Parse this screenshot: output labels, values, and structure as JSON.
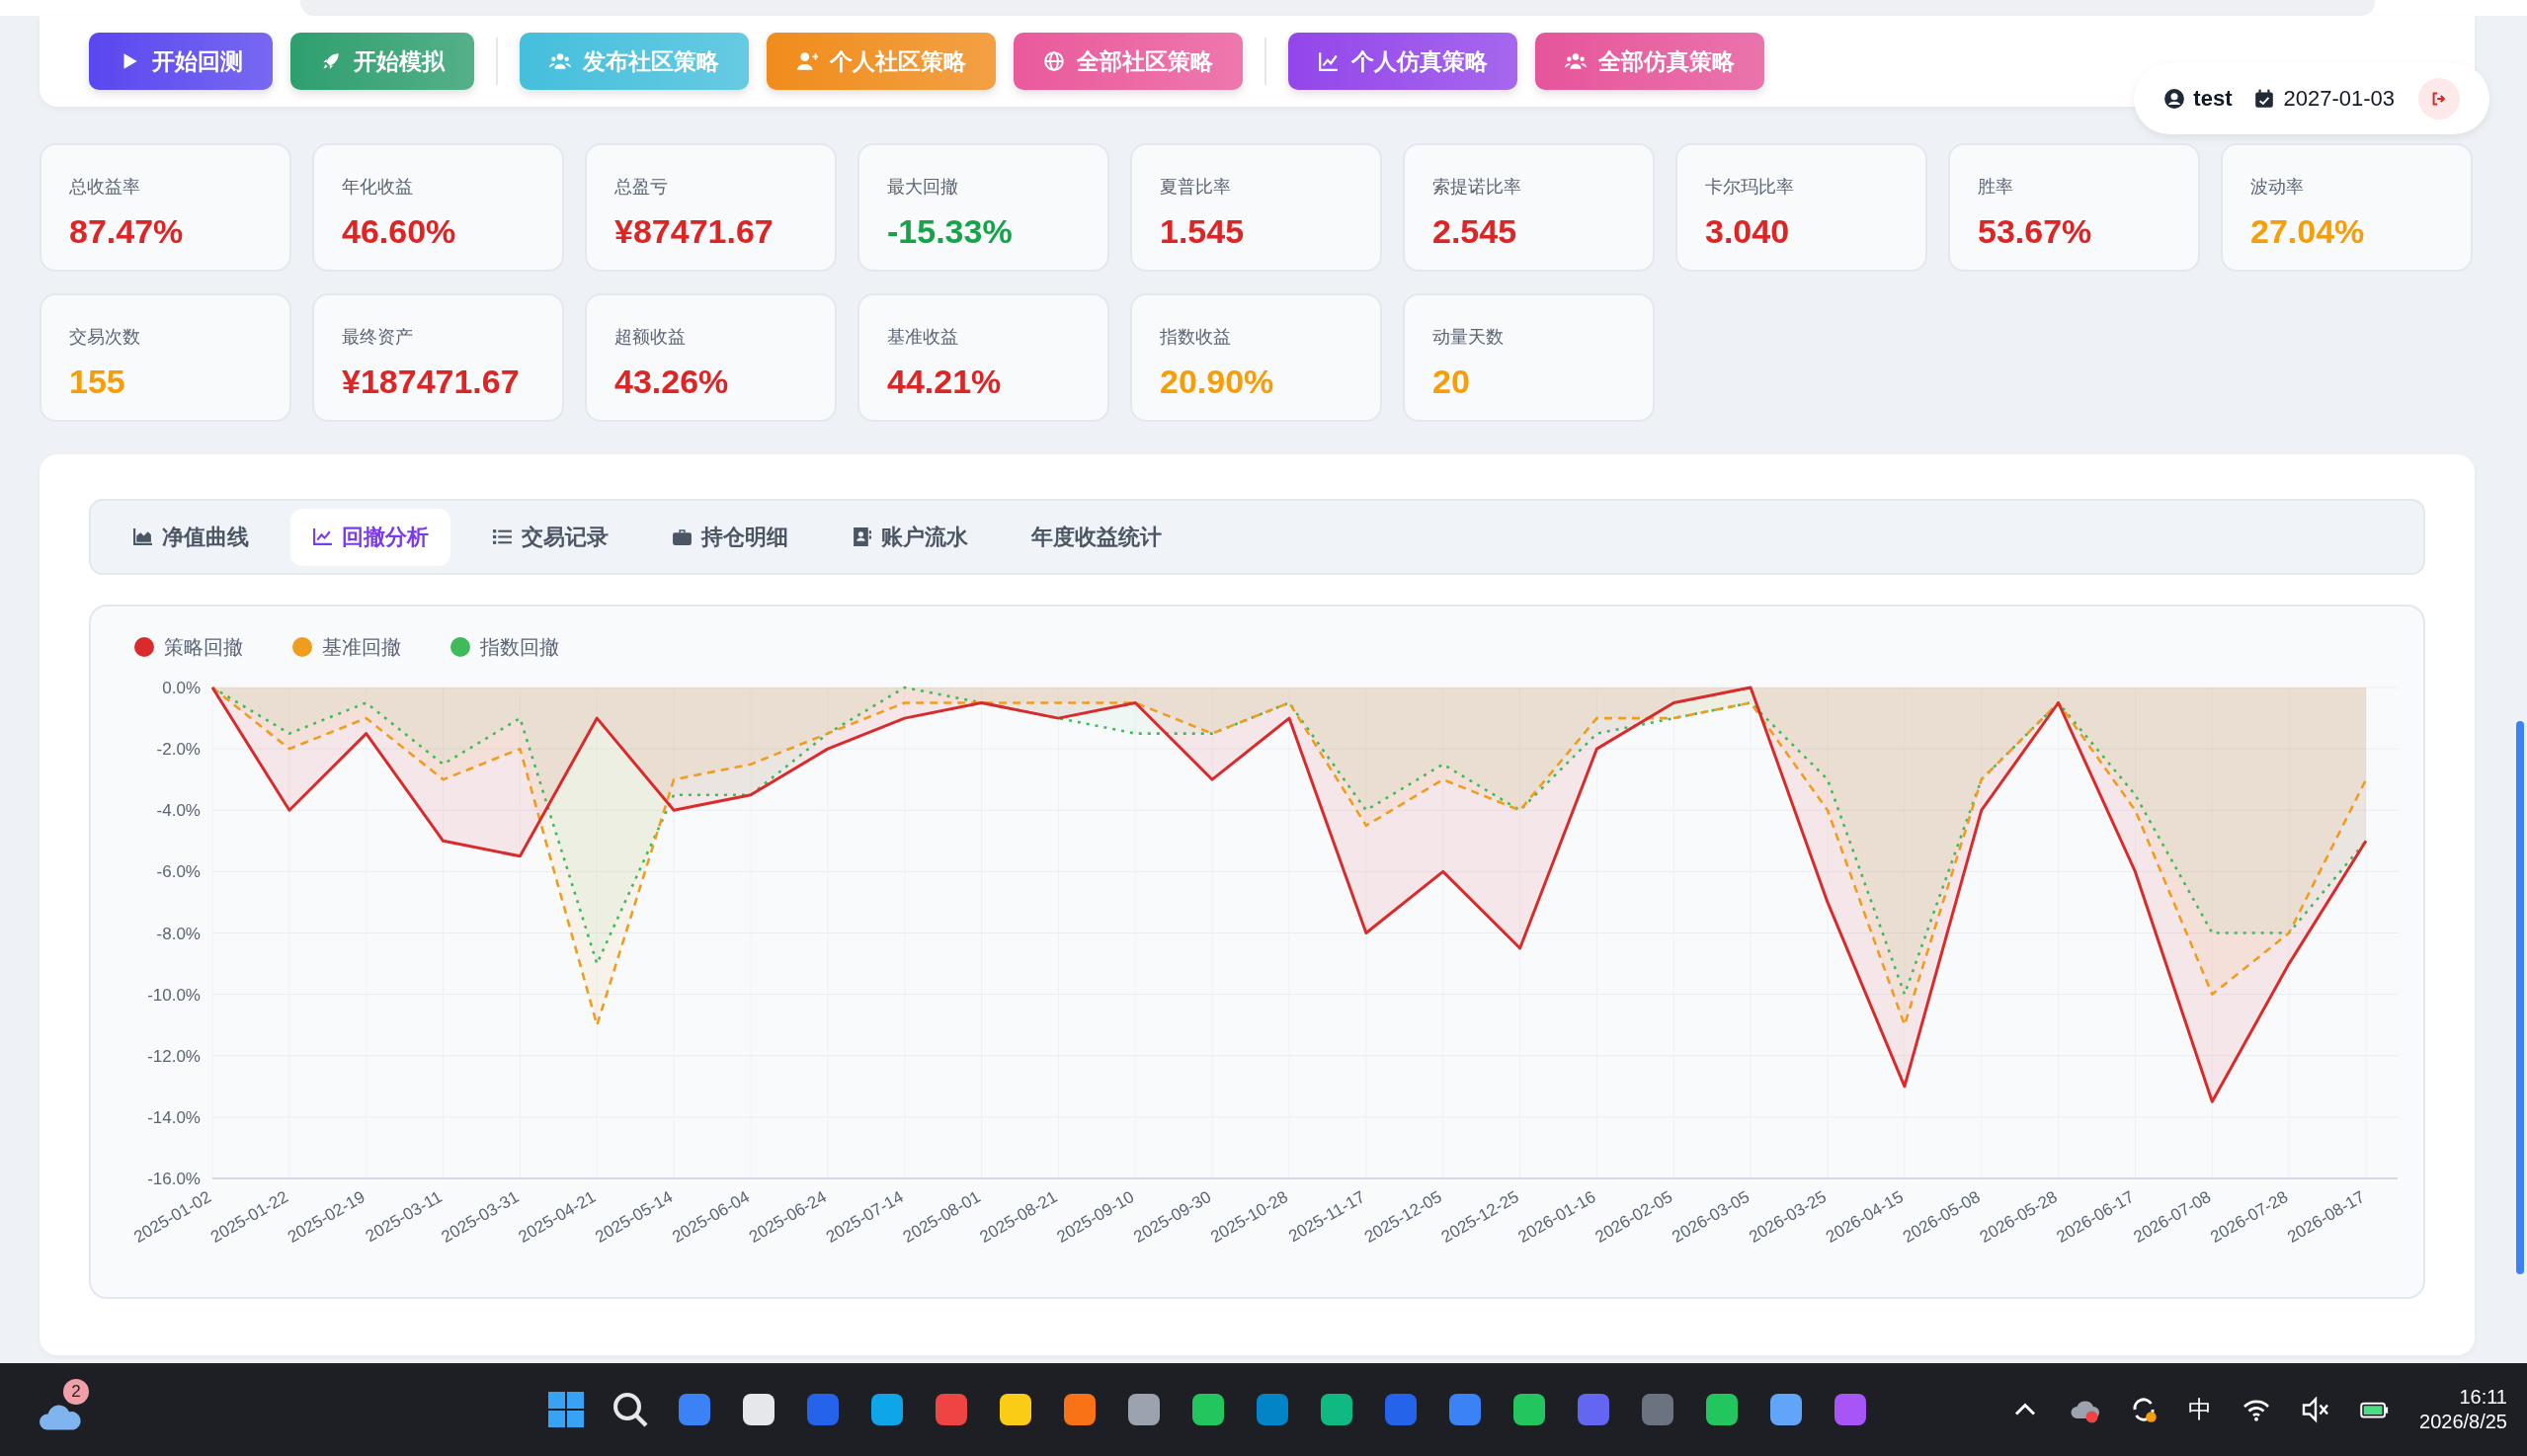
{
  "toolbar": {
    "button_groups": [
      [
        {
          "label": "开始回测",
          "color": "#5a47ef"
        },
        {
          "label": "开始模拟",
          "color": "#2f9f6f"
        }
      ],
      [
        {
          "label": "发布社区策略",
          "color": "#45bfdc"
        },
        {
          "label": "个人社区策略",
          "color": "#f08c1c"
        },
        {
          "label": "全部社区策略",
          "color": "#ea5a9c"
        }
      ],
      [
        {
          "label": "个人仿真策略",
          "color": "#9346ea"
        },
        {
          "label": "全部仿真策略",
          "color": "#e6559a"
        }
      ]
    ]
  },
  "user": {
    "name": "test",
    "date": "2027-01-03"
  },
  "stats": [
    [
      {
        "label": "总收益率",
        "value": "87.47%",
        "color": "#dc2626"
      },
      {
        "label": "年化收益",
        "value": "46.60%",
        "color": "#dc2626"
      },
      {
        "label": "总盈亏",
        "value": "¥87471.67",
        "color": "#dc2626"
      },
      {
        "label": "最大回撤",
        "value": "-15.33%",
        "color": "#16a34a"
      },
      {
        "label": "夏普比率",
        "value": "1.545",
        "color": "#dc2626"
      },
      {
        "label": "索提诺比率",
        "value": "2.545",
        "color": "#dc2626"
      },
      {
        "label": "卡尔玛比率",
        "value": "3.040",
        "color": "#dc2626"
      },
      {
        "label": "胜率",
        "value": "53.67%",
        "color": "#dc2626"
      },
      {
        "label": "波动率",
        "value": "27.04%",
        "color": "#f59e0b"
      }
    ],
    [
      {
        "label": "交易次数",
        "value": "155",
        "color": "#f59e0b"
      },
      {
        "label": "最终资产",
        "value": "¥187471.67",
        "color": "#dc2626"
      },
      {
        "label": "超额收益",
        "value": "43.26%",
        "color": "#dc2626"
      },
      {
        "label": "基准收益",
        "value": "44.21%",
        "color": "#dc2626"
      },
      {
        "label": "指数收益",
        "value": "20.90%",
        "color": "#f59e0b"
      },
      {
        "label": "动量天数",
        "value": "20",
        "color": "#f59e0b"
      }
    ]
  ],
  "tabs": [
    {
      "label": "净值曲线",
      "selected": false
    },
    {
      "label": "回撤分析",
      "selected": true
    },
    {
      "label": "交易记录",
      "selected": false
    },
    {
      "label": "持仓明细",
      "selected": false
    },
    {
      "label": "账户流水",
      "selected": false
    },
    {
      "label": "年度收益统计",
      "selected": false
    }
  ],
  "chart_data": {
    "type": "area",
    "grid": true,
    "ylim": [
      -16,
      0
    ],
    "yticks": [
      {
        "value": 0,
        "label": "0.0%"
      },
      {
        "value": -2,
        "label": "-2.0%"
      },
      {
        "value": -4,
        "label": "-4.0%"
      },
      {
        "value": -6,
        "label": "-6.0%"
      },
      {
        "value": -8,
        "label": "-8.0%"
      },
      {
        "value": -10,
        "label": "-10.0%"
      },
      {
        "value": -12,
        "label": "-12.0%"
      },
      {
        "value": -14,
        "label": "-14.0%"
      },
      {
        "value": -16,
        "label": "-16.0%"
      }
    ],
    "categories": [
      "2025-01-02",
      "2025-01-22",
      "2025-02-19",
      "2025-03-11",
      "2025-03-31",
      "2025-04-21",
      "2025-05-14",
      "2025-06-04",
      "2025-06-24",
      "2025-07-14",
      "2025-08-01",
      "2025-08-21",
      "2025-09-10",
      "2025-09-30",
      "2025-10-28",
      "2025-11-17",
      "2025-12-05",
      "2025-12-25",
      "2026-01-16",
      "2026-02-05",
      "2026-03-05",
      "2026-03-25",
      "2026-04-15",
      "2026-05-08",
      "2026-05-28",
      "2026-06-17",
      "2026-07-08",
      "2026-07-28",
      "2026-08-17"
    ],
    "series": [
      {
        "name": "策略回撤",
        "color": "#d92b2b",
        "values": [
          0,
          -4,
          -1.5,
          -5,
          -5.5,
          -1,
          -4,
          -3.5,
          -2,
          -1,
          -0.5,
          -1,
          -0.5,
          -3,
          -1,
          -8,
          -6,
          -8.5,
          -2,
          -0.5,
          0,
          -7,
          -13,
          -4,
          -0.5,
          -6,
          -13.5,
          -9,
          -5
        ]
      },
      {
        "name": "基准回撤",
        "color": "#ef9d1f",
        "values": [
          0,
          -2,
          -1,
          -3,
          -2,
          -11,
          -3,
          -2.5,
          -1.5,
          -0.5,
          -0.5,
          -0.5,
          -0.5,
          -1.5,
          -0.5,
          -4.5,
          -3,
          -4,
          -1,
          -1,
          -0.5,
          -4,
          -11,
          -3,
          -0.5,
          -4,
          -10,
          -8,
          -3
        ]
      },
      {
        "name": "指数回撤",
        "color": "#3fbb5c",
        "values": [
          0,
          -1.5,
          -0.5,
          -2.5,
          -1,
          -9,
          -3.5,
          -3.5,
          -1.5,
          0,
          -0.5,
          -1,
          -1.5,
          -1.5,
          -0.5,
          -4,
          -2.5,
          -4,
          -1.5,
          -1,
          -0.5,
          -3,
          -10,
          -3,
          -0.5,
          -3.5,
          -8,
          -8,
          -5
        ]
      }
    ]
  },
  "taskbar": {
    "weather_badge": "2",
    "ime": "中",
    "time": "16:11",
    "date": "2026/8/25"
  }
}
